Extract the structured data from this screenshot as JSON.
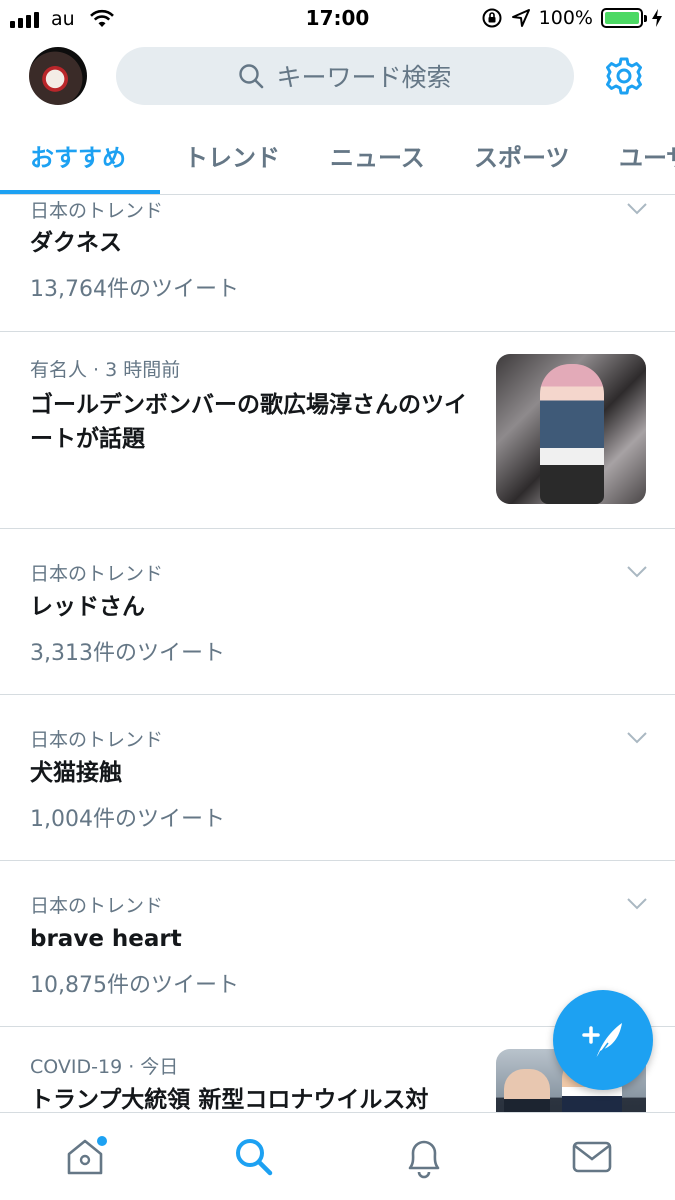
{
  "status_bar": {
    "carrier": "au",
    "time": "17:00",
    "battery_percent": "100%",
    "battery_level": 1.0,
    "battery_color": "#4cd964"
  },
  "header": {
    "search_placeholder": "キーワード検索",
    "avatar_icon": "avatar",
    "settings_icon": "gear-icon"
  },
  "tabs": [
    {
      "label": "おすすめ",
      "active": true
    },
    {
      "label": "トレンド"
    },
    {
      "label": "ニュース"
    },
    {
      "label": "スポーツ"
    },
    {
      "label": "ユーザ"
    }
  ],
  "feed": [
    {
      "meta": "日本のトレンド",
      "title": "ダクネス",
      "count": "13,764件のツイート"
    },
    {
      "meta": "有名人 · 3 時間前",
      "title": "ゴールデンボンバーの歌広場淳さんのツイートが話題",
      "thumbnail": "photo"
    },
    {
      "meta": "日本のトレンド",
      "title": "レッドさん",
      "count": "3,313件のツイート"
    },
    {
      "meta": "日本のトレンド",
      "title": "犬猫接触",
      "count": "1,004件のツイート"
    },
    {
      "meta": "日本のトレンド",
      "title": "brave heart",
      "count": "10,875件のツイート"
    },
    {
      "meta": "COVID-19 · 今日",
      "title": "トランプ大統領 新型コロナウイルス対",
      "thumbnail": "photo"
    }
  ],
  "fab": {
    "icon": "compose-tweet-icon"
  },
  "tabbar": [
    {
      "icon": "home-icon",
      "badge": true
    },
    {
      "icon": "search-icon",
      "active": true
    },
    {
      "icon": "notifications-icon"
    },
    {
      "icon": "messages-icon"
    }
  ],
  "colors": {
    "accent": "#1da1f2",
    "secondary_text": "#657786",
    "primary_text": "#14171a"
  }
}
